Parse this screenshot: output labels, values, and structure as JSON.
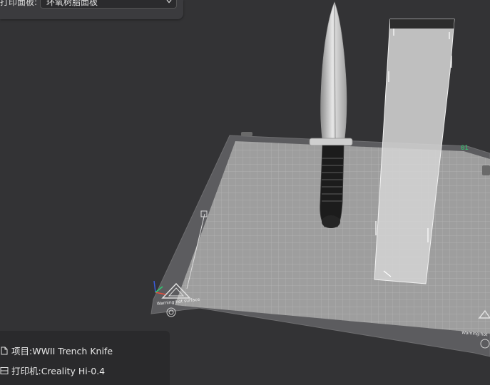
{
  "plate_settings": {
    "label": "打印面板:",
    "selected": "环氧树脂面板"
  },
  "info": {
    "project_label": "项目:WWII Trench Knife",
    "printer_label": "打印机:Creality Hi-0.4"
  },
  "bed": {
    "plate_number": "01",
    "warning_text_left": "Warning:hot surface",
    "warning_text_right": "Warning:hot"
  },
  "icons": {
    "project": "file-icon",
    "printer": "printer-icon",
    "dropdown": "chevron-down-icon"
  },
  "colors": {
    "background": "#333335",
    "plate_number": "#2ecc71",
    "axis_x": "#e74c3c",
    "axis_y": "#2ecc71",
    "axis_z": "#3b5bdb"
  }
}
